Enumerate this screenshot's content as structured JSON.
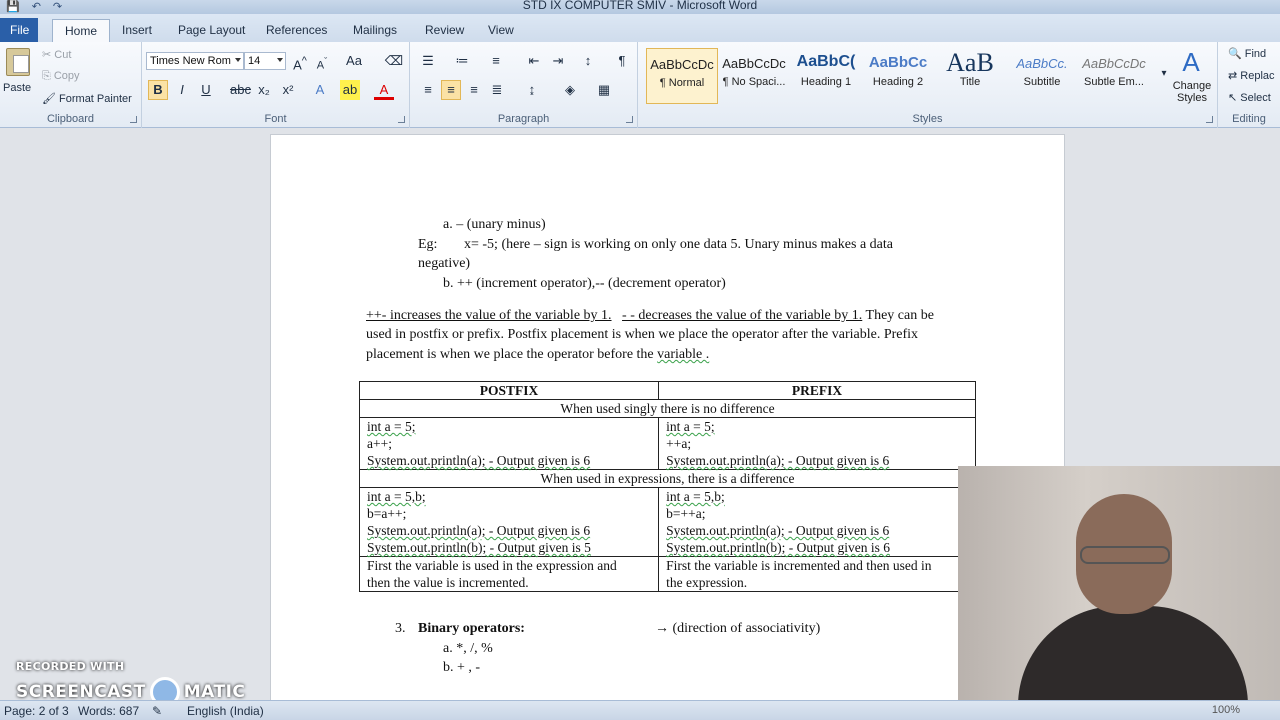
{
  "window": {
    "title": "STD IX COMPUTER SMIV  -  Microsoft Word"
  },
  "tabs": [
    "File",
    "Home",
    "Insert",
    "Page Layout",
    "References",
    "Mailings",
    "Review",
    "View"
  ],
  "clipboard": {
    "paste": "Paste",
    "cut": "Cut",
    "copy": "Copy",
    "format_painter": "Format Painter",
    "label": "Clipboard"
  },
  "font": {
    "name": "Times New Rom",
    "size": "14",
    "label": "Font"
  },
  "paragraph": {
    "label": "Paragraph"
  },
  "styles": {
    "label": "Styles",
    "items": [
      {
        "preview": "AaBbCcDc",
        "name": "¶ Normal"
      },
      {
        "preview": "AaBbCcDc",
        "name": "¶ No Spaci..."
      },
      {
        "preview": "AaBbC(",
        "name": "Heading 1"
      },
      {
        "preview": "AaBbCc",
        "name": "Heading 2"
      },
      {
        "preview": "AaB",
        "name": "Title"
      },
      {
        "preview": "AaBbCc.",
        "name": "Subtitle"
      },
      {
        "preview": "AaBbCcDc",
        "name": "Subtle Em..."
      }
    ],
    "change": "Change Styles"
  },
  "editing": {
    "find": "Find",
    "replace": "Replac",
    "select": "Select",
    "label": "Editing"
  },
  "document": {
    "a_item": "a.    – (unary minus)",
    "eg_prefix": "Eg:",
    "eg_text": "x= -5; (here – sign is working on only one data 5. Unary minus makes a data",
    "eg_cont": "negative)",
    "b_item": "b.    ++ (increment operator),-- (decrement operator)",
    "para1_line1_a": "++- increases the value of the variable by 1.",
    "para1_line1_b": "- - decreases the value of the variable by 1.",
    "para1_line1_c": "They can be",
    "para1_line2": "used in postfix or prefix. Postfix placement is when we place the operator after the variable. Prefix",
    "para1_line3_a": "placement is when we place the operator before the",
    "para1_line3_b": "variable .",
    "table": {
      "headers": [
        "POSTFIX",
        "PREFIX"
      ],
      "row_single": "When used singly there is no difference",
      "postfix_single": [
        "int a = 5;",
        "a++;",
        "System.out.println(a); - Output given is 6"
      ],
      "prefix_single": [
        "int a = 5;",
        "++a;",
        "System.out.println(a); - Output given is 6"
      ],
      "row_expr": "When used in expressions, there is a difference",
      "postfix_expr": [
        "int a = 5,b;",
        "b=a++;",
        "System.out.println(a); - Output given is 6",
        "System.out.println(b); - Output given is 5"
      ],
      "prefix_expr": [
        "int a = 5,b;",
        "b=++a;",
        "System.out.println(a); - Output given is 6",
        "System.out.println(b); - Output given is 6"
      ],
      "postfix_desc": [
        "First the variable is used in the expression and",
        "then the value is incremented."
      ],
      "prefix_desc": [
        "First the variable is incremented and then used in",
        "the expression."
      ]
    },
    "item3_num": "3.",
    "item3_title": "Binary operators:",
    "item3_assoc": "→ (direction of associativity)",
    "item3_a": "a.    *, /, %",
    "item3_b": "b.    + , -"
  },
  "status": {
    "page": "Page: 2 of 3",
    "words": "Words: 687",
    "language": "English (India)",
    "zoom": "100%"
  },
  "watermark": {
    "top": "RECORDED WITH",
    "left": "SCREENCAST",
    "right": "MATIC"
  }
}
